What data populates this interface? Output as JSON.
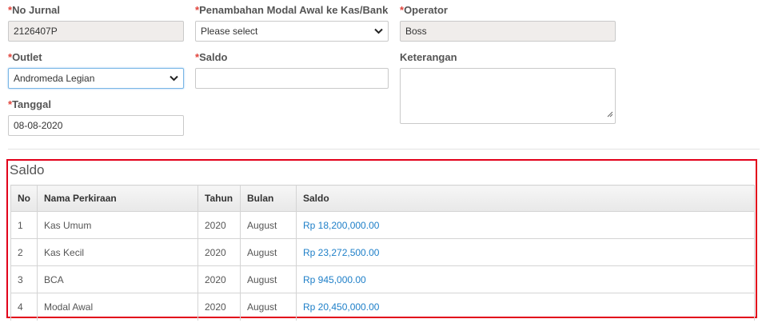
{
  "form": {
    "no_jurnal": {
      "label": "No Jurnal",
      "value": "2126407P"
    },
    "penambahan": {
      "label": "Penambahan Modal Awal ke Kas/Bank",
      "value": "Please select"
    },
    "operator": {
      "label": "Operator",
      "value": "Boss"
    },
    "outlet": {
      "label": "Outlet",
      "value": "Andromeda Legian"
    },
    "saldo": {
      "label": "Saldo",
      "value": ""
    },
    "keterangan": {
      "label": "Keterangan",
      "value": ""
    },
    "tanggal": {
      "label": "Tanggal",
      "value": "08-08-2020"
    },
    "required_mark": "*"
  },
  "saldo_section": {
    "title": "Saldo",
    "columns": [
      "No",
      "Nama Perkiraan",
      "Tahun",
      "Bulan",
      "Saldo"
    ],
    "rows": [
      {
        "no": "1",
        "nama": "Kas Umum",
        "tahun": "2020",
        "bulan": "August",
        "saldo": "Rp 18,200,000.00"
      },
      {
        "no": "2",
        "nama": "Kas Kecil",
        "tahun": "2020",
        "bulan": "August",
        "saldo": "Rp 23,272,500.00"
      },
      {
        "no": "3",
        "nama": "BCA",
        "tahun": "2020",
        "bulan": "August",
        "saldo": "Rp 945,000.00"
      },
      {
        "no": "4",
        "nama": "Modal Awal",
        "tahun": "2020",
        "bulan": "August",
        "saldo": "Rp 20,450,000.00"
      }
    ]
  },
  "colors": {
    "required": "#e0433b",
    "highlight_border": "#e2001a",
    "money": "#1e7fc8"
  }
}
